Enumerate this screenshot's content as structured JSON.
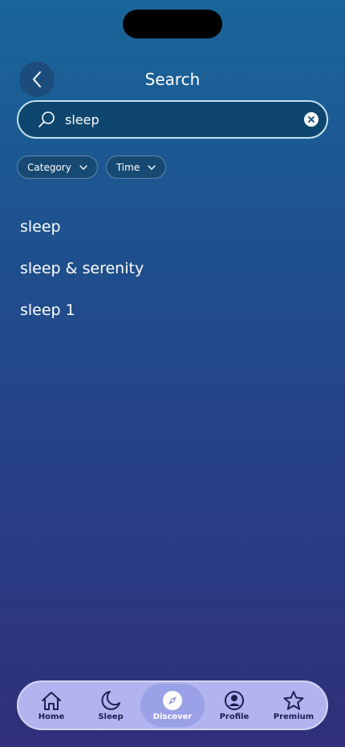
{
  "header": {
    "title": "Search"
  },
  "search": {
    "value": "sleep"
  },
  "filters": [
    {
      "label": "Category"
    },
    {
      "label": "Time"
    }
  ],
  "results": [
    {
      "label": "sleep"
    },
    {
      "label": "sleep & serenity"
    },
    {
      "label": "sleep 1"
    }
  ],
  "tabbar": {
    "tabs": [
      {
        "label": "Home",
        "icon": "home-icon"
      },
      {
        "label": "Sleep",
        "icon": "moon-icon"
      },
      {
        "label": "Discover",
        "icon": "compass-icon",
        "active": true
      },
      {
        "label": "Profile",
        "icon": "profile-icon"
      },
      {
        "label": "Premium",
        "icon": "star-icon"
      }
    ]
  },
  "colors": {
    "background_top": "#19669a",
    "background_bottom": "#2f3079",
    "tabbar": "#b1b4ef",
    "tab_active": "#9aa1e6"
  }
}
